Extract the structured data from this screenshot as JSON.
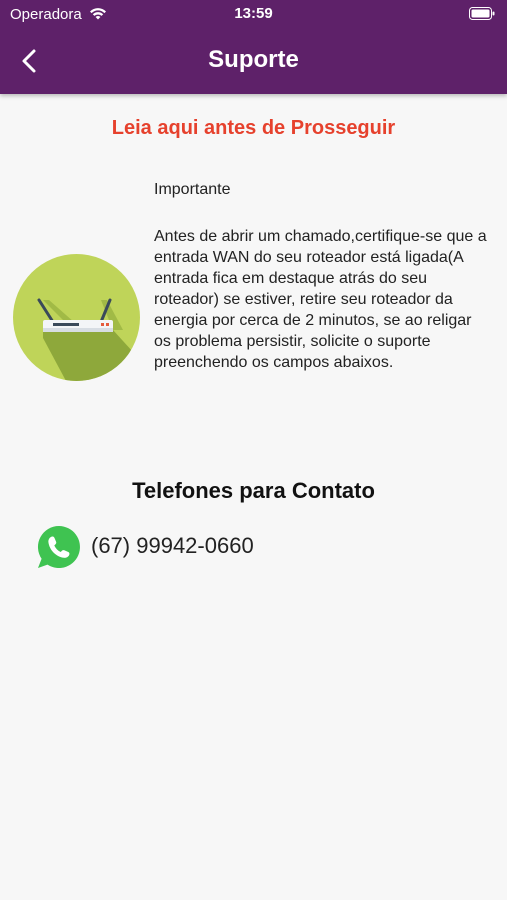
{
  "status_bar": {
    "carrier": "Operadora",
    "time": "13:59"
  },
  "header": {
    "title": "Suporte",
    "background": "#5e2169"
  },
  "notice": {
    "title": "Leia aqui antes de Prosseguir",
    "title_color": "#e6412d",
    "label": "Importante",
    "text": "Antes de abrir um chamado,certifique-se que a entrada WAN do seu roteador está ligada(A entrada fica em destaque atrás do seu roteador) se estiver, retire seu roteador da energia por cerca de 2 minutos, se ao religar os problema persistir, solicite o suporte preenchendo os campos abaixos."
  },
  "contacts": {
    "heading": "Telefones para Contato",
    "phones": [
      {
        "icon": "whatsapp-icon",
        "number": "(67) 99942-0660"
      }
    ]
  },
  "icons": {
    "back": "chevron-left-icon",
    "illustration": "router-icon",
    "wifi": "wifi-icon",
    "battery": "battery-icon"
  }
}
